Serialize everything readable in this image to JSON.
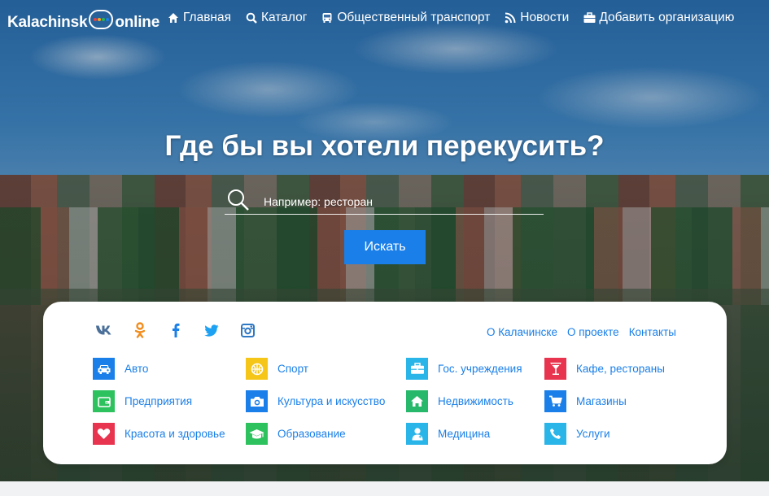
{
  "logo": {
    "text_left": "Kalachinsk",
    "text_right": "online",
    "dot_colors": [
      "#e8433f",
      "#f5a623",
      "#2fb24c",
      "#1a7fe8"
    ]
  },
  "nav": [
    {
      "label": "Главная",
      "icon": "home-icon"
    },
    {
      "label": "Каталог",
      "icon": "search-icon"
    },
    {
      "label": "Общественный транспорт",
      "icon": "bus-icon"
    },
    {
      "label": "Новости",
      "icon": "rss-icon"
    },
    {
      "label": "Добавить организацию",
      "icon": "briefcase-icon"
    }
  ],
  "hero": {
    "headline": "Где бы вы хотели перекусить?",
    "search_placeholder": "Например: ресторан",
    "search_button": "Искать"
  },
  "social": [
    {
      "name": "vk-icon",
      "color": "#4a6f99"
    },
    {
      "name": "odnoklassniki-icon",
      "color": "#f28c1c"
    },
    {
      "name": "facebook-icon",
      "color": "#1a7fe8"
    },
    {
      "name": "twitter-icon",
      "color": "#1da1f2"
    },
    {
      "name": "instagram-icon",
      "color": "#2f78c4"
    }
  ],
  "links": [
    "О Калачинске",
    "О проекте",
    "Контакты"
  ],
  "categories": [
    {
      "label": "Авто",
      "icon": "car-icon",
      "color": "#1a7fe8"
    },
    {
      "label": "Спорт",
      "icon": "ball-icon",
      "color": "#f5c518"
    },
    {
      "label": "Гос. учреждения",
      "icon": "briefcase-icon",
      "color": "#2ab5e8"
    },
    {
      "label": "Кафе, рестораны",
      "icon": "cocktail-icon",
      "color": "#e8344e"
    },
    {
      "label": "Предприятия",
      "icon": "wallet-icon",
      "color": "#2ec25f"
    },
    {
      "label": "Культура и искусство",
      "icon": "camera-icon",
      "color": "#1a7fe8"
    },
    {
      "label": "Недвижимость",
      "icon": "house-icon",
      "color": "#27b86b"
    },
    {
      "label": "Магазины",
      "icon": "cart-icon",
      "color": "#1a7fe8"
    },
    {
      "label": "Красота и здоровье",
      "icon": "heart-icon",
      "color": "#e8344e"
    },
    {
      "label": "Образование",
      "icon": "graduation-cap-icon",
      "color": "#2ec25f"
    },
    {
      "label": "Медицина",
      "icon": "doctor-icon",
      "color": "#2ab5e8"
    },
    {
      "label": "Услуги",
      "icon": "phone-icon",
      "color": "#2ab5e8"
    }
  ]
}
